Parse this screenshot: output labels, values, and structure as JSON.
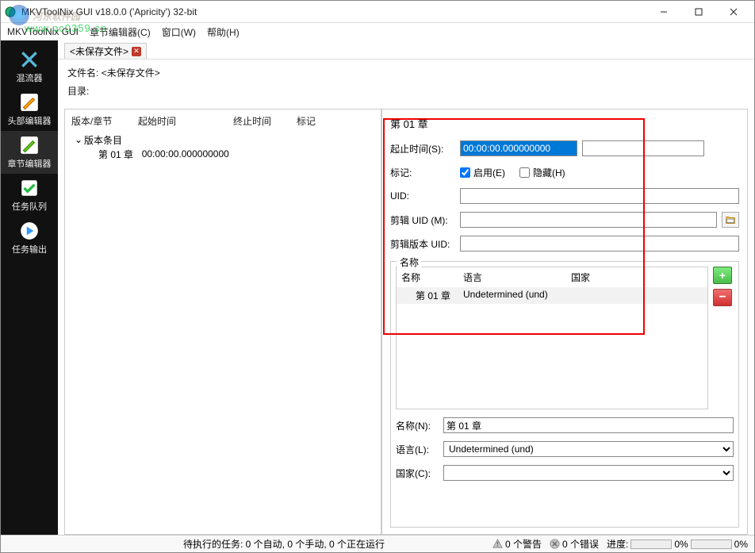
{
  "window": {
    "title": "MKVToolNix GUI v18.0.0 ('Apricity') 32-bit"
  },
  "menubar": {
    "app": "MKVToolNix GUI",
    "chapter": "章节编辑器(C)",
    "window": "窗口(W)",
    "help": "帮助(H)"
  },
  "watermark": {
    "line1": "河东软件园",
    "line2": "www.pc0359.cn"
  },
  "sidebar": {
    "items": [
      {
        "label": "混流器"
      },
      {
        "label": "头部编辑器"
      },
      {
        "label": "章节编辑器"
      },
      {
        "label": "任务队列"
      },
      {
        "label": "任务输出"
      }
    ]
  },
  "tabs": {
    "tab0": "<未保存文件>"
  },
  "fileinfo": {
    "filename_label": "文件名:",
    "filename_value": "<未保存文件>",
    "dir_label": "目录:"
  },
  "tree": {
    "headers": {
      "c1": "版本/章节",
      "c2": "起始时间",
      "c3": "终止时间",
      "c4": "标记"
    },
    "root": "版本条目",
    "child": {
      "name": "第 01 章",
      "time": "00:00:00.000000000"
    }
  },
  "detail": {
    "title": "第 01 章",
    "start_label": "起止时间(S):",
    "start_value": "00:00:00.000000000",
    "flags_label": "标记:",
    "enabled_label": "启用(E)",
    "hidden_label": "隐藏(H)",
    "uid_label": "UID:",
    "segment_uid_label": "剪辑 UID (M):",
    "segment_edition_uid_label": "剪辑版本 UID:",
    "names_group_label": "名称",
    "names_header": {
      "c1": "名称",
      "c2": "语言",
      "c3": "国家"
    },
    "names_row": {
      "name": "第 01 章",
      "lang": "Undetermined (und)"
    },
    "name_label": "名称(N):",
    "name_value": "第 01 章",
    "lang_label": "语言(L):",
    "lang_value": "Undetermined (und)",
    "country_label": "国家(C):"
  },
  "statusbar": {
    "pending": "待执行的任务: 0 个自动, 0 个手动, 0 个正在运行",
    "warnings": "0 个警告",
    "errors": "0 个错误",
    "progress_label": "进度:",
    "progress_pct1": "0%",
    "progress_pct2": "0%"
  }
}
